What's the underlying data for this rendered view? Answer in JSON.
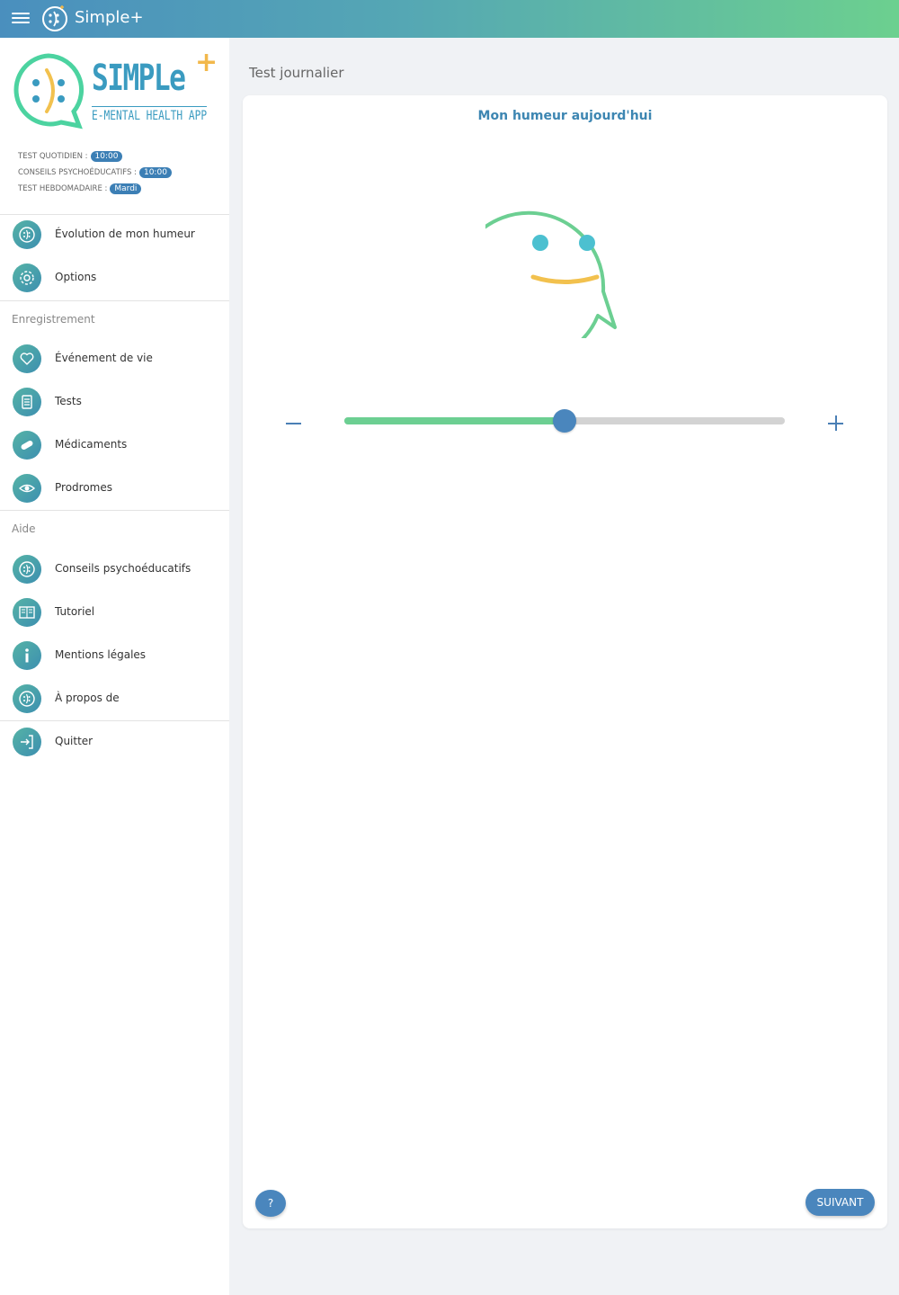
{
  "appbar": {
    "title": "Simple+",
    "menu_icon": "hamburger-icon",
    "logo_icon": "simple-logo-icon"
  },
  "sidebar": {
    "brand": {
      "word": "SIMPLe",
      "plus": "+",
      "subtitle": "E-MENTAL HEALTH APP"
    },
    "schedules": [
      {
        "label": "TEST QUOTIDIEN :",
        "value": "10:00"
      },
      {
        "label": "CONSEILS PSYCHOÉDUCATIFS :",
        "value": "10:00"
      },
      {
        "label": "TEST HEBDOMADAIRE :",
        "value": "Mardi"
      }
    ],
    "top_items": [
      {
        "label": "Évolution de mon humeur",
        "icon": "mood-face-icon"
      },
      {
        "label": "Options",
        "icon": "gear-icon"
      }
    ],
    "section_recording": "Enregistrement",
    "recording_items": [
      {
        "label": "Événement de vie",
        "icon": "heart-icon"
      },
      {
        "label": "Tests",
        "icon": "document-icon"
      },
      {
        "label": "Médicaments",
        "icon": "pill-icon"
      },
      {
        "label": "Prodromes",
        "icon": "eye-icon"
      }
    ],
    "section_help": "Aide",
    "help_items": [
      {
        "label": "Conseils psychoéducatifs",
        "icon": "mood-face-icon"
      },
      {
        "label": "Tutoriel",
        "icon": "book-icon"
      },
      {
        "label": "Mentions légales",
        "icon": "info-icon"
      },
      {
        "label": "À propos de",
        "icon": "mood-face-icon"
      }
    ],
    "quit_item": {
      "label": "Quitter",
      "icon": "exit-icon"
    }
  },
  "main": {
    "heading": "Test journalier",
    "card_title": "Mon humeur aujourd'hui",
    "mood_level": 0.5,
    "help_label": "?",
    "next_label": "SUIVANT"
  },
  "colors": {
    "accent": "#4a86bd",
    "green": "#6ccf92",
    "title_blue": "#3d86b2",
    "smile": "#f2c14e",
    "eyes": "#4cc0d0"
  }
}
